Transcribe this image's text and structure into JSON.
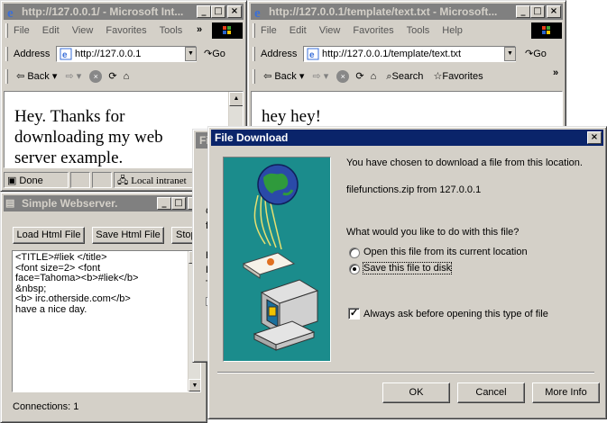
{
  "browser1": {
    "title": "http://127.0.0.1/ - Microsoft Int...",
    "menu": [
      "File",
      "Edit",
      "View",
      "Favorites",
      "Tools"
    ],
    "chevron": "»",
    "address_label": "Address",
    "address_value": "http://127.0.0.1",
    "go_label": "Go",
    "back_label": "Back",
    "content_text": "Hey. Thanks for downloading my web server example.",
    "status_done": "Done",
    "status_zone": "Local intranet"
  },
  "browser2": {
    "title": "http://127.0.0.1/template/text.txt - Microsoft...",
    "menu": [
      "File",
      "Edit",
      "View",
      "Favorites",
      "Tools",
      "Help"
    ],
    "address_label": "Address",
    "address_value": "http://127.0.0.1/template/text.txt",
    "go_label": "Go",
    "back_label": "Back",
    "search_label": "Search",
    "favorites_label": "Favorites",
    "content_text": "hey hey!"
  },
  "webserver": {
    "title": "Simple Webserver.",
    "load_label": "Load Html File",
    "save_label": "Save Html File",
    "stop_label": "Stop",
    "html_text": "<TITLE>#liek </title>\n<font size=2> <font\nface=Tahoma><b>#liek</b>\n&nbsp;\n<b> irc.otherside.com</b>\nhave a nice day.",
    "connections": "Connections: 1"
  },
  "hidden_dialog": {
    "title": "File",
    "letters": [
      "G",
      "fi",
      "E",
      "D",
      "T"
    ]
  },
  "download": {
    "title": "File Download",
    "message": "You have chosen to download a file from this location.",
    "file_source": "filefunctions.zip from 127.0.0.1",
    "question": "What would you like to do with this file?",
    "option_open": "Open this file from its current location",
    "option_save": "Save this file to disk",
    "selected_option": "save",
    "always_ask": "Always ask before opening this type of file",
    "always_ask_checked": true,
    "ok_label": "OK",
    "cancel_label": "Cancel",
    "more_info_label": "More Info"
  },
  "colors": {
    "titlebar_active": "#0a246a",
    "titlebar_inactive": "#808080",
    "face": "#d4d0c8",
    "illustration_bg": "#1b8c8c"
  }
}
